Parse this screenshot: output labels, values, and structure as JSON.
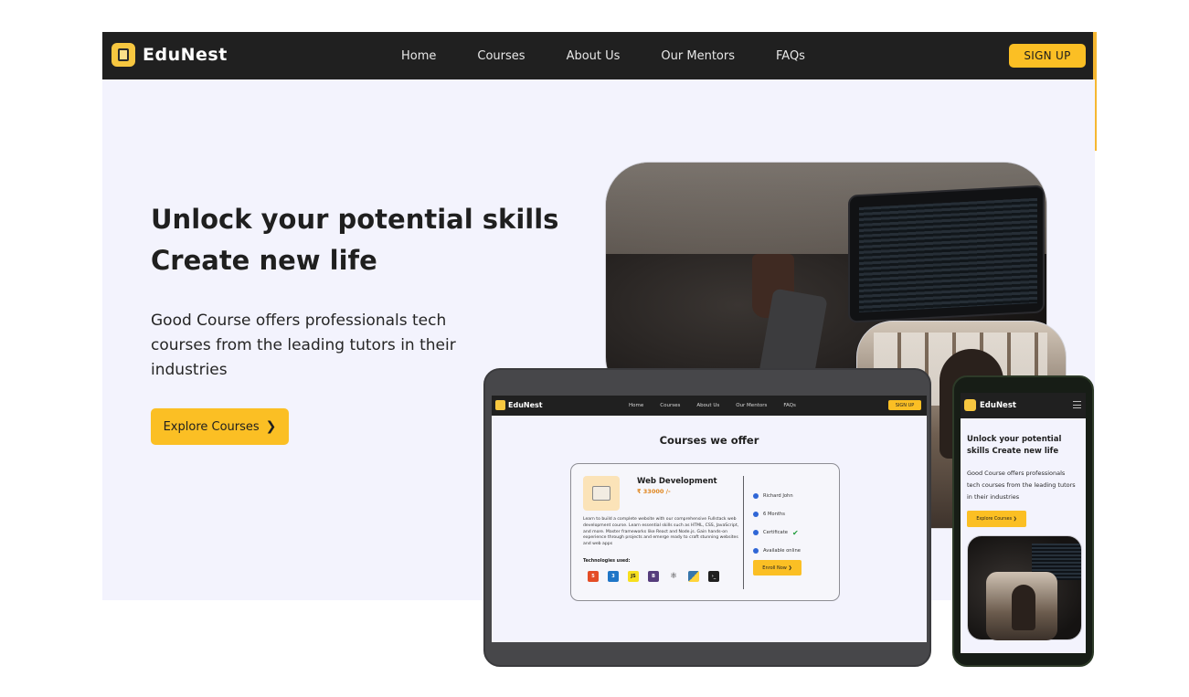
{
  "brand": {
    "name": "EduNest"
  },
  "nav": {
    "links": [
      "Home",
      "Courses",
      "About Us",
      "Our Mentors",
      "FAQs"
    ],
    "signup_label": "SIGN UP"
  },
  "hero": {
    "title_line1": "Unlock your potential skills",
    "title_line2": "Create new life",
    "description": "Good Course offers professionals tech courses from the leading tutors in their industries",
    "cta_label": "Explore Courses"
  },
  "tablet": {
    "nav_links": [
      "Home",
      "Courses",
      "About Us",
      "Our Mentors",
      "FAQs"
    ],
    "signup_label": "SIGN UP",
    "heading": "Courses we offer",
    "card": {
      "title": "Web Development",
      "price": "₹ 33000 /-",
      "description": "Learn to build a complete website with our comprehensive Fullstack web development course. Learn essential skills such as HTML, CSS, JavaScript, and more. Master frameworks like React and Node.js. Gain hands-on experience through projects and emerge ready to craft stunning websites and web apps",
      "tech_label": "Technologies used:",
      "tech_icons": [
        "html5-icon",
        "css3-icon",
        "javascript-icon",
        "bootstrap-icon",
        "react-icon",
        "python-icon",
        "terminal-icon"
      ],
      "mentor": "Richard John",
      "duration": "6 Months",
      "certificate": "Certificate",
      "availability": "Available online",
      "enroll_label": "Enroll Now"
    }
  },
  "phone": {
    "title": "Unlock your potential skills Create new life",
    "description": "Good Course offers professionals tech courses from the leading tutors in their industries",
    "cta_label": "Explore Courses"
  },
  "colors": {
    "accent": "#fbbf24",
    "nav_bg": "#202020",
    "hero_bg": "#f3f3fd",
    "price": "#e0861e"
  }
}
